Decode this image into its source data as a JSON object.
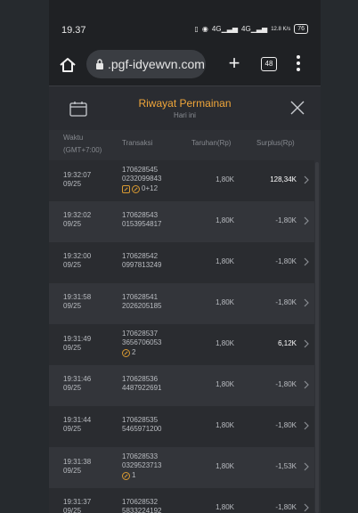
{
  "status_bar": {
    "time": "19.37",
    "signal_1": "4G",
    "signal_2": "4G",
    "data_rate": "12.8 K/s",
    "battery": "76"
  },
  "browser": {
    "url": ".pgf-idyewvn.com",
    "tab_count": "48"
  },
  "modal": {
    "title": "Riwayat Permainan",
    "subtitle": "Hari ini"
  },
  "columns": {
    "time": "Waktu",
    "timezone": "(GMT+7:00)",
    "transaction": "Transaksi",
    "bet": "Taruhan(Rp)",
    "surplus": "Surplus(Rp)"
  },
  "rows": [
    {
      "time": "19:32:07",
      "date": "09/25",
      "id1": "170628545",
      "id2": "0232099843",
      "badge": "0+12",
      "bet": "1,80K",
      "surplus": "128,34K",
      "positive": true
    },
    {
      "time": "19:32:02",
      "date": "09/25",
      "id1": "170628543",
      "id2": "0153954817",
      "badge": "",
      "bet": "1,80K",
      "surplus": "-1,80K",
      "positive": false
    },
    {
      "time": "19:32:00",
      "date": "09/25",
      "id1": "170628542",
      "id2": "0997813249",
      "badge": "",
      "bet": "1,80K",
      "surplus": "-1,80K",
      "positive": false
    },
    {
      "time": "19:31:58",
      "date": "09/25",
      "id1": "170628541",
      "id2": "2026205185",
      "badge": "",
      "bet": "1,80K",
      "surplus": "-1,80K",
      "positive": false
    },
    {
      "time": "19:31:49",
      "date": "09/25",
      "id1": "170628537",
      "id2": "3656706053",
      "badge": "2",
      "bet": "1,80K",
      "surplus": "6,12K",
      "positive": true
    },
    {
      "time": "19:31:46",
      "date": "09/25",
      "id1": "170628536",
      "id2": "4487922691",
      "badge": "",
      "bet": "1,80K",
      "surplus": "-1,80K",
      "positive": false
    },
    {
      "time": "19:31:44",
      "date": "09/25",
      "id1": "170628535",
      "id2": "5465971200",
      "badge": "",
      "bet": "1,80K",
      "surplus": "-1,80K",
      "positive": false
    },
    {
      "time": "19:31:38",
      "date": "09/25",
      "id1": "170628533",
      "id2": "0329523713",
      "badge": "1",
      "bet": "1,80K",
      "surplus": "-1,53K",
      "positive": false
    },
    {
      "time": "19:31:37",
      "date": "09/25",
      "id1": "170628532",
      "id2": "5833224192",
      "badge": "",
      "bet": "1,80K",
      "surplus": "-1,80K",
      "positive": false
    }
  ],
  "colors": {
    "accent": "#f0a63a",
    "badge": "#d89a32"
  }
}
